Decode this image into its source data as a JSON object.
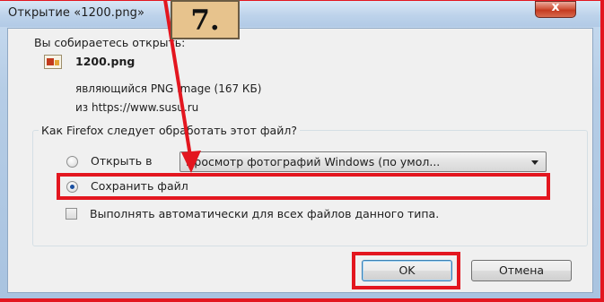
{
  "window": {
    "title": "Открытие «1200.png»",
    "close_glyph": "x"
  },
  "intro": {
    "prompt": "Вы собираетесь открыть:",
    "file_name": "1200.png",
    "file_icon": "png-image-icon",
    "type_line": "являющийся  PNG Image (167 КБ)",
    "source_line": "из  https://www.susu.ru"
  },
  "action_group": {
    "title": "Как Firefox следует обработать этот файл?",
    "open_with_label": "Открыть в",
    "open_with_value": "Просмотр фотографий Windows (по умол...",
    "open_with_selected": false,
    "save_label": "Сохранить файл",
    "save_selected": true,
    "auto_label": "Выполнять автоматически для всех файлов данного типа.",
    "auto_checked": false
  },
  "buttons": {
    "ok": "OK",
    "cancel": "Отмена"
  },
  "annotation": {
    "step_label": "7.",
    "highlight_color": "#e3161f",
    "badge_color": "#e7c38d"
  }
}
